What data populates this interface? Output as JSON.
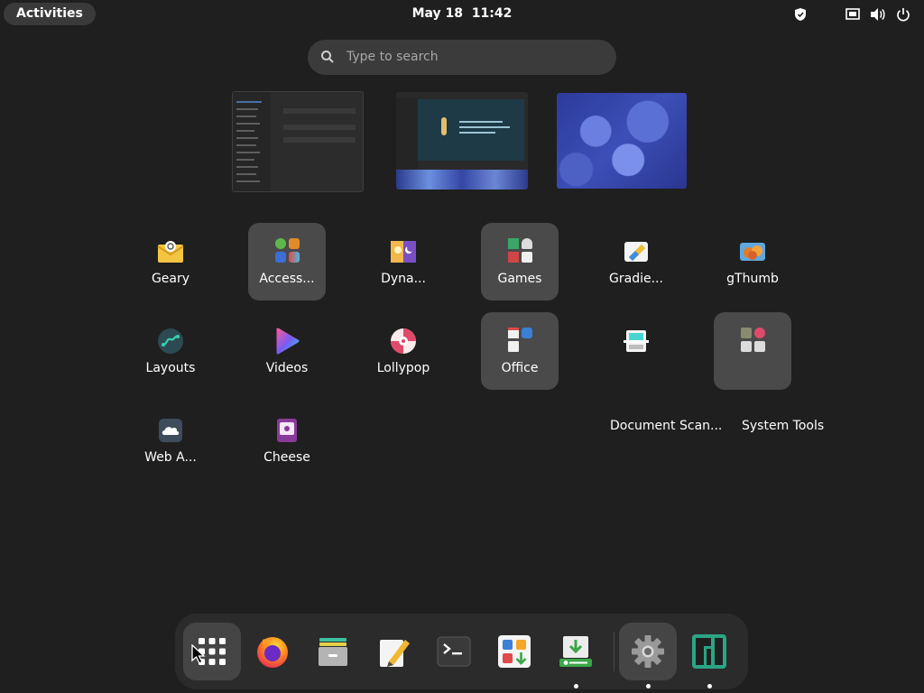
{
  "topbar": {
    "activities_label": "Activities",
    "date": "May 18",
    "time": "11:42",
    "tray_icons": [
      "shield-icon",
      "network-wired-icon",
      "volume-icon",
      "power-icon"
    ]
  },
  "search": {
    "placeholder": "Type to search"
  },
  "windows": [
    {
      "name": "settings-window-thumbnail"
    },
    {
      "name": "game-window-thumbnail"
    },
    {
      "name": "wallpaper-window-thumbnail"
    }
  ],
  "apps": {
    "geary": "Geary",
    "accessories": "Access...",
    "dynamic_wallpaper": "Dyna...",
    "games": "Games",
    "gradience": "Gradie...",
    "gthumb": "gThumb",
    "layouts": "Layouts",
    "videos": "Videos",
    "lollypop": "Lollypop",
    "office": "Office",
    "document_scanner": "Document Scan...",
    "system_tools": "System Tools",
    "web_apps": "Web A...",
    "cheese": "Cheese"
  },
  "dock": {
    "items": [
      {
        "icon": "app-grid-icon",
        "active": true,
        "running": false
      },
      {
        "icon": "firefox-icon",
        "active": false,
        "running": false
      },
      {
        "icon": "file-manager-icon",
        "active": false,
        "running": false
      },
      {
        "icon": "text-editor-icon",
        "active": false,
        "running": false
      },
      {
        "icon": "terminal-icon",
        "active": false,
        "running": false
      },
      {
        "icon": "software-center-icon",
        "active": false,
        "running": false
      },
      {
        "icon": "package-installer-icon",
        "active": false,
        "running": true
      },
      {
        "icon": "settings-gear-icon",
        "active": true,
        "running": true
      },
      {
        "icon": "manjaro-logo-icon",
        "active": false,
        "running": true
      }
    ]
  },
  "colors": {
    "background": "#1f1f1f",
    "folder_tile": "#4a4a4a",
    "search_bg": "#3b3b3b",
    "dock_bg": "#2b2b2b"
  }
}
